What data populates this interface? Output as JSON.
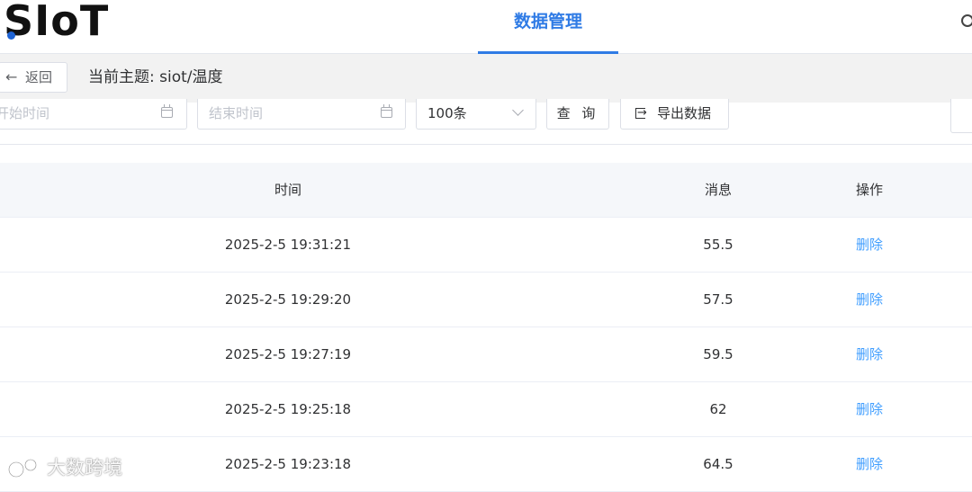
{
  "header": {
    "logo": "SIoT",
    "nav_tab": "数据管理",
    "search_icon": "search-icon"
  },
  "topic_bar": {
    "back_label": "返回",
    "back_icon": "arrow-left-icon",
    "topic": "当前主题: siot/温度"
  },
  "filters": {
    "start_placeholder": "开始时间",
    "end_placeholder": "结束时间",
    "limit_value": "100条",
    "query_label": "查 询",
    "export_label": "导出数据",
    "calendar_icon": "calendar-icon",
    "export_icon": "export-icon"
  },
  "table": {
    "columns": [
      "时间",
      "消息",
      "操作"
    ],
    "rows": [
      {
        "time": "2025-2-5 19:31:21",
        "message": "55.5",
        "action": "删除"
      },
      {
        "time": "2025-2-5 19:29:20",
        "message": "57.5",
        "action": "删除"
      },
      {
        "time": "2025-2-5 19:27:19",
        "message": "59.5",
        "action": "删除"
      },
      {
        "time": "2025-2-5 19:25:18",
        "message": "62",
        "action": "删除"
      },
      {
        "time": "2025-2-5 19:23:18",
        "message": "64.5",
        "action": "删除"
      }
    ]
  },
  "watermark": {
    "text": "大数跨境"
  },
  "colors": {
    "accent": "#2f7be5",
    "link": "#409eff",
    "logo_dot": "#1e63d4"
  }
}
